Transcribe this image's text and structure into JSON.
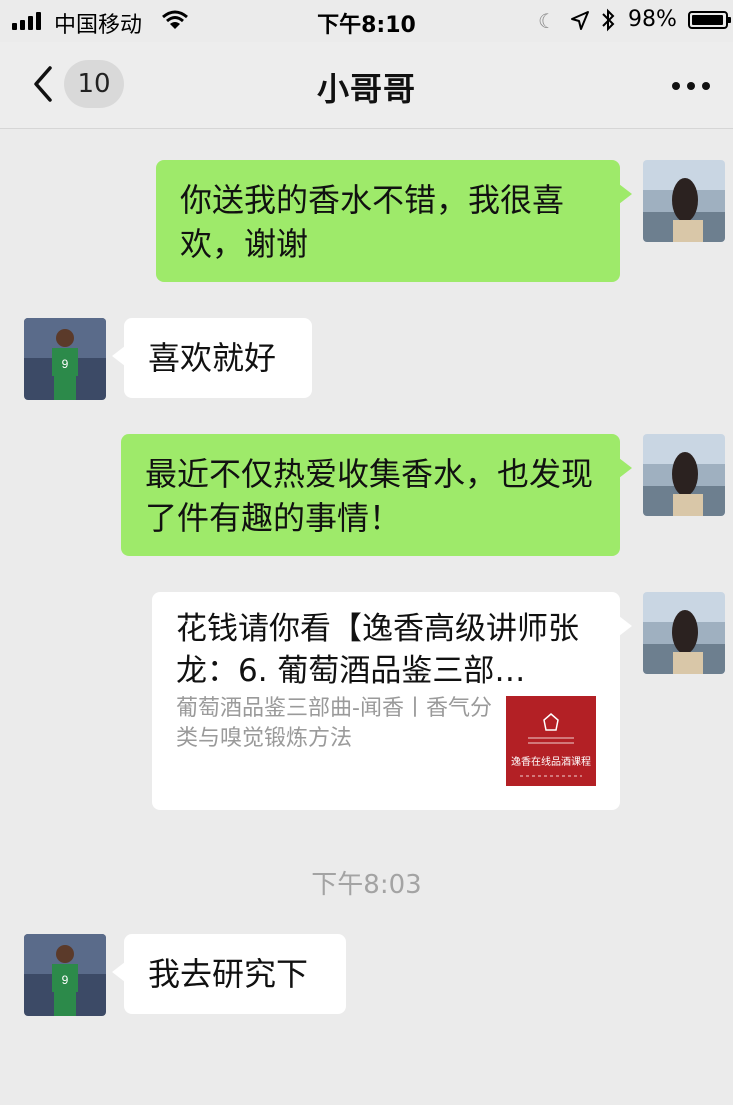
{
  "status_bar": {
    "carrier": "中国移动",
    "time": "下午8:10",
    "battery_percent": "98%",
    "battery_level": 0.98,
    "icons": [
      "signal-icon",
      "wifi-icon",
      "moon-icon",
      "location-icon",
      "bluetooth-icon",
      "battery-icon"
    ]
  },
  "nav": {
    "unread_count": "10",
    "title": "小哥哥",
    "icons": [
      "back-chevron-icon",
      "more-dots-icon"
    ]
  },
  "messages": [
    {
      "sender": "self",
      "text": "你送我的香水不错，我很喜欢，谢谢"
    },
    {
      "sender": "other",
      "text": "喜欢就好"
    },
    {
      "sender": "self",
      "text": "最近不仅热爱收集香水，也发现了件有趣的事情！"
    },
    {
      "sender": "self",
      "type": "link-card",
      "title": "花钱请你看【逸香高级讲师张龙：6. 葡萄酒品鉴三部…",
      "description": "葡萄酒品鉴三部曲-闻香丨香气分类与嗅觉锻炼方法",
      "thumbnail_text": "逸香在线品酒课程"
    },
    {
      "sender": "other",
      "text": "我去研究下"
    }
  ],
  "timestamp": "下午8:03",
  "colors": {
    "background": "#ebebeb",
    "self_bubble": "#9eea6a",
    "other_bubble": "#ffffff",
    "thumbnail": "#b32025"
  }
}
